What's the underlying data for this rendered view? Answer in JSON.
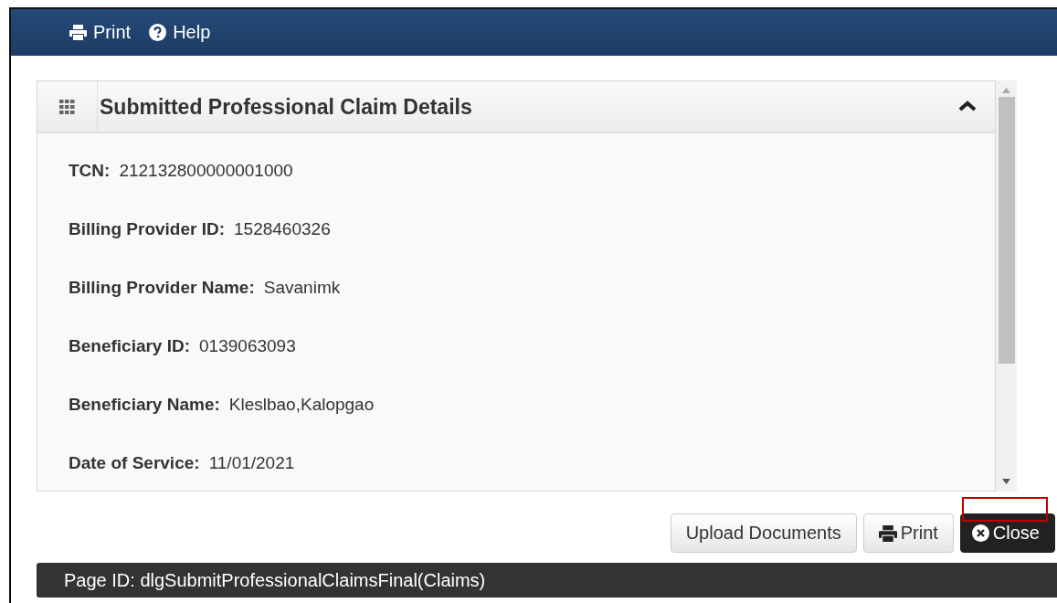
{
  "toolbar": [
    {
      "kind": "print",
      "label": "Print"
    },
    {
      "kind": "help",
      "label": "Help"
    }
  ],
  "panel": {
    "title": "Submitted Professional Claim Details",
    "expanded": true,
    "fields": [
      {
        "label": "TCN:",
        "value": "212132800000001000"
      },
      {
        "label": "Billing Provider ID:",
        "value": "1528460326"
      },
      {
        "label": "Billing Provider Name:",
        "value": "Savanimk"
      },
      {
        "label": "Beneficiary ID:",
        "value": "0139063093"
      },
      {
        "label": "Beneficiary Name:",
        "value": "Kleslbao,Kalopgao"
      },
      {
        "label": "Date of Service:",
        "value": "11/01/2021"
      }
    ]
  },
  "buttons": [
    {
      "kind": "plain",
      "label": "Upload Documents",
      "highlighted": false
    },
    {
      "kind": "print",
      "label": "Print",
      "highlighted": false
    },
    {
      "kind": "close",
      "label": "Close",
      "highlighted": true
    }
  ],
  "footer": "Page ID: dlgSubmitProfessionalClaimsFinal(Claims)"
}
